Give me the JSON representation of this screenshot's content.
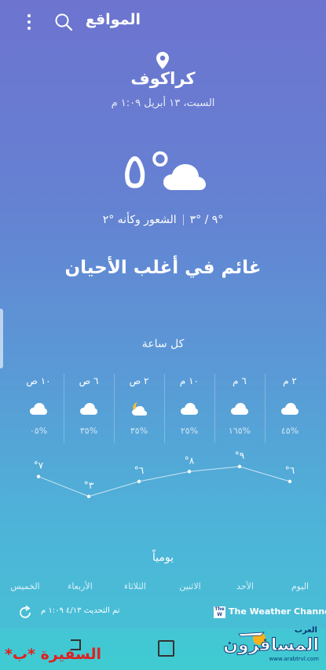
{
  "header": {
    "title": "المواقع",
    "menu_icon": "more-vert-icon",
    "search_icon": "search-icon"
  },
  "location": {
    "city": "كراكوف",
    "datetime": "السبت، ١٣ أبريل ١:٠٩ م"
  },
  "current": {
    "temperature": "°٥",
    "high_low": "°٩ / °٣",
    "feels_like": "الشعور وكأنه °٢",
    "condition": "غائم في أغلب الأحيان",
    "icon": "cloud-icon"
  },
  "hourly": {
    "title": "كل ساعة",
    "items": [
      {
        "time": "٢ م",
        "icon": "cloud-icon",
        "rain": "%٤٥",
        "temp": "°٦",
        "value": 6
      },
      {
        "time": "٦ م",
        "icon": "cloud-icon",
        "rain": "%١٦٥",
        "temp": "°٩",
        "value": 9
      },
      {
        "time": "١٠ م",
        "icon": "cloud-icon",
        "rain": "%٢٥",
        "temp": "°٨",
        "value": 8
      },
      {
        "time": "٢ ص",
        "icon": "moon-cloud-icon",
        "rain": "%٣٥",
        "temp": "°٦",
        "value": 6
      },
      {
        "time": "٦ ص",
        "icon": "cloud-icon",
        "rain": "%٣٥",
        "temp": "°٣",
        "value": 3
      },
      {
        "time": "١٠ ص",
        "icon": "cloud-icon",
        "rain": "%٠٥",
        "temp": "°٧",
        "value": 7
      }
    ]
  },
  "daily": {
    "title": "يومياً",
    "days": [
      "اليوم",
      "الأحد",
      "الاثنين",
      "الثلاثاء",
      "الأربعاء",
      "الخميس"
    ]
  },
  "footer": {
    "updated": "تم التحديث ٤/١٣ ١:٠٩ م",
    "provider": "The Weather Channel",
    "provider_logo_text": "The Weather Channel"
  },
  "overlay": {
    "watermark": "السفيرة *ب*",
    "site_name": "المسافرون",
    "site_small": "العرب",
    "site_url": "www.arabtrvl.com"
  },
  "colors": {
    "bg_top": "#6d74cf",
    "bg_bottom": "#45c3d5",
    "watermark": "#e02020"
  }
}
